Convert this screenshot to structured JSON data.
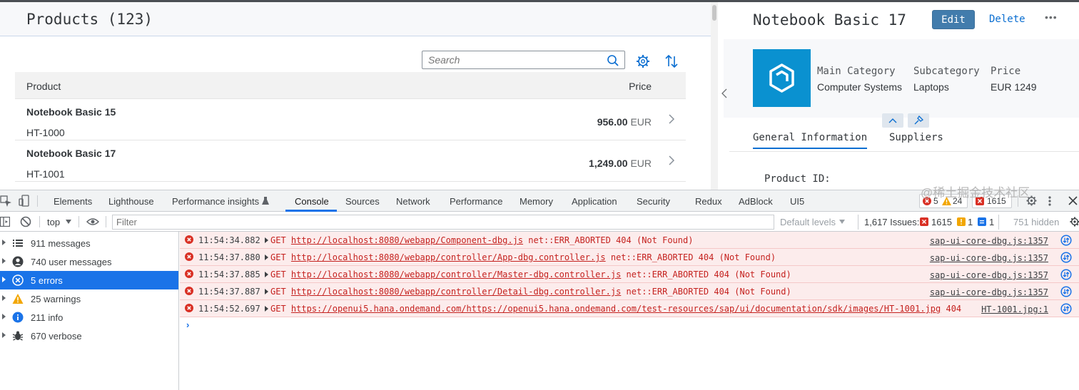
{
  "app": {
    "master": {
      "title": "Products (123)",
      "search_placeholder": "Search",
      "columns": {
        "product": "Product",
        "price": "Price"
      },
      "rows": [
        {
          "name": "Notebook Basic 15",
          "id": "HT-1000",
          "price": "956.00",
          "currency": "EUR"
        },
        {
          "name": "Notebook Basic 17",
          "id": "HT-1001",
          "price": "1,249.00",
          "currency": "EUR"
        }
      ]
    },
    "detail": {
      "title": "Notebook Basic 17",
      "edit_label": "Edit",
      "delete_label": "Delete",
      "more_label": "•••",
      "attributes": [
        {
          "label": "Main Category",
          "value": "Computer Systems"
        },
        {
          "label": "Subcategory",
          "value": "Laptops"
        },
        {
          "label": "Price",
          "value": "EUR 1249"
        }
      ],
      "tabs": [
        "General Information",
        "Suppliers"
      ],
      "product_id_label": "Product ID:"
    }
  },
  "devtools": {
    "tabs": [
      "Elements",
      "Lighthouse",
      "Performance insights",
      "Console",
      "Sources",
      "Network",
      "Performance",
      "Memory",
      "Application",
      "Security",
      "Redux",
      "AdBlock",
      "UI5"
    ],
    "active_tab": "Console",
    "badges": {
      "errors": "5",
      "warnings": "24",
      "issues": "1615"
    },
    "toolbar": {
      "context": "top",
      "filter_placeholder": "Filter",
      "levels": "Default levels",
      "issues_label": "1,617 Issues:",
      "issues_errors": "1615",
      "issues_warnings": "1",
      "issues_info": "1",
      "hidden": "751 hidden"
    },
    "sidebar": [
      {
        "label": "911 messages",
        "icon": "list-icon"
      },
      {
        "label": "740 user messages",
        "icon": "user-icon"
      },
      {
        "label": "5 errors",
        "icon": "error-icon",
        "selected": true
      },
      {
        "label": "25 warnings",
        "icon": "warning-icon"
      },
      {
        "label": "211 info",
        "icon": "info-icon"
      },
      {
        "label": "670 verbose",
        "icon": "bug-icon"
      }
    ],
    "logs": [
      {
        "time": "11:54:34.882",
        "method": "GET",
        "url": "http://localhost:8080/webapp/Component-dbg.js",
        "error": "net::ERR_ABORTED 404 (Not Found)",
        "source": "sap-ui-core-dbg.js:1357"
      },
      {
        "time": "11:54:37.880",
        "method": "GET",
        "url": "http://localhost:8080/webapp/controller/App-dbg.controller.js",
        "error": "net::ERR_ABORTED 404 (Not Found)",
        "source": "sap-ui-core-dbg.js:1357"
      },
      {
        "time": "11:54:37.885",
        "method": "GET",
        "url": "http://localhost:8080/webapp/controller/Master-dbg.controller.js",
        "error": "net::ERR_ABORTED 404 (Not Found)",
        "source": "sap-ui-core-dbg.js:1357"
      },
      {
        "time": "11:54:37.887",
        "method": "GET",
        "url": "http://localhost:8080/webapp/controller/Detail-dbg.controller.js",
        "error": "net::ERR_ABORTED 404 (Not Found)",
        "source": "sap-ui-core-dbg.js:1357"
      },
      {
        "time": "11:54:52.697",
        "method": "GET",
        "url": "https://openui5.hana.ondemand.com/https://openui5.hana.ondemand.com/test-resources/sap/ui/documentation/sdk/images/HT-1001.jpg",
        "error": "404",
        "source": "HT-1001.jpg:1"
      }
    ],
    "prompt": "›"
  },
  "watermark": "@稀土掘金技术社区"
}
